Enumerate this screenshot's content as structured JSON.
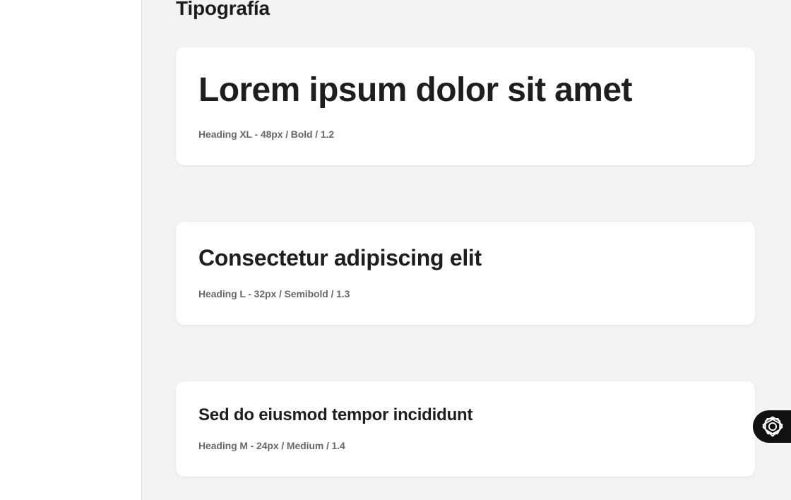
{
  "section": {
    "title": "Tipografía"
  },
  "typography": [
    {
      "sample": "Lorem ipsum dolor sit amet",
      "spec": "Heading XL - 48px / Bold / 1.2"
    },
    {
      "sample": "Consectetur adipiscing elit",
      "spec": "Heading L - 32px / Semibold / 1.3"
    },
    {
      "sample": "Sed do eiusmod tempor incididunt",
      "spec": "Heading M - 24px / Medium / 1.4"
    }
  ],
  "floating_button": {
    "icon": "assistant-icon",
    "background": "#111111",
    "icon_color": "#ffffff"
  },
  "colors": {
    "page_background": "#f3f3f3",
    "card_background": "#ffffff",
    "heading_text": "#1e1e1e",
    "spec_text": "#686868"
  }
}
